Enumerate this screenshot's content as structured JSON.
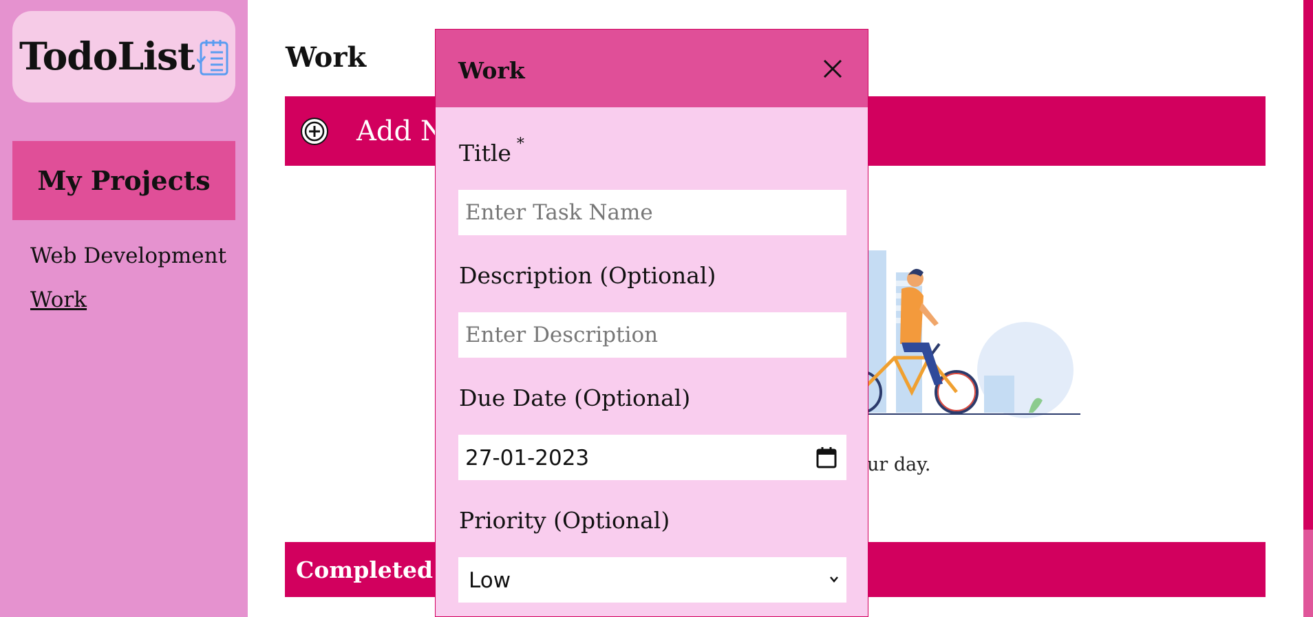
{
  "sidebar": {
    "logo_text": "TodoList",
    "logo_icon": "notepad-checklist-icon",
    "projects_title": "My Projects",
    "projects": [
      {
        "label": "Web Development",
        "active": false
      },
      {
        "label": "Work",
        "active": true
      }
    ]
  },
  "main": {
    "page_title": "Work",
    "add_task_label": "Add N",
    "add_icon": "plus-circle-icon",
    "empty_message": "ur day.",
    "illustration": "man-riding-bicycle-city-illustration",
    "completed_label": "Completed Ta"
  },
  "modal": {
    "title": "Work",
    "close_icon": "close-icon",
    "title_label": "Title",
    "required_marker": "*",
    "title_placeholder": "Enter Task Name",
    "description_label": "Description (Optional)",
    "description_placeholder": "Enter Description",
    "due_date_label": "Due Date (Optional)",
    "due_date_value": "27-01-2023",
    "calendar_icon": "calendar-icon",
    "priority_label": "Priority (Optional)",
    "priority_value": "Low",
    "chevron_icon": "chevron-down-icon"
  },
  "colors": {
    "sidebar_bg": "#e592cf",
    "logo_card_bg": "#f6cbe7",
    "accent_pink": "#e04f98",
    "bar_magenta": "#d2005e",
    "modal_bg": "#f9cdee"
  }
}
